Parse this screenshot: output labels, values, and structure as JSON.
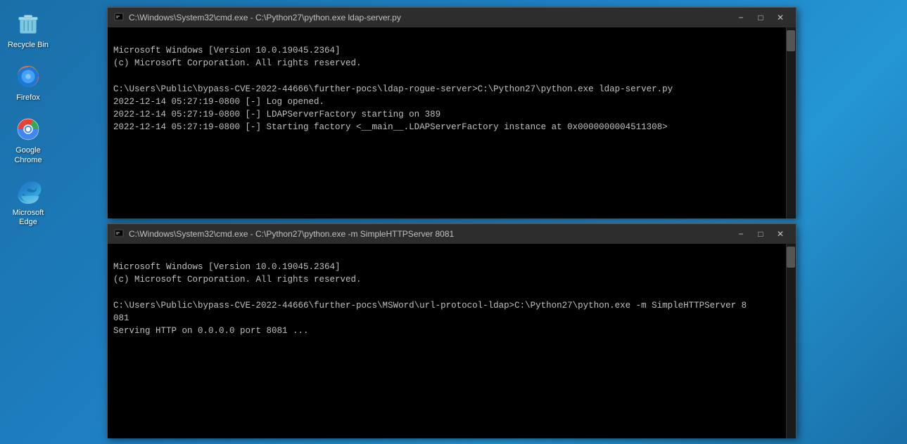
{
  "desktop": {
    "icons": [
      {
        "id": "recycle-bin",
        "label": "Recycle Bin",
        "type": "recycle"
      },
      {
        "id": "firefox",
        "label": "Firefox",
        "type": "firefox"
      },
      {
        "id": "chrome",
        "label": "Google Chrome",
        "type": "chrome"
      },
      {
        "id": "edge",
        "label": "Microsoft Edge",
        "type": "edge"
      }
    ]
  },
  "windows": [
    {
      "id": "cmd-ldap",
      "title": "C:\\Windows\\System32\\cmd.exe - C:\\Python27\\python.exe ldap-server.py",
      "minimize_label": "−",
      "maximize_label": "□",
      "close_label": "✕",
      "content": [
        "Microsoft Windows [Version 10.0.19045.2364]",
        "(c) Microsoft Corporation. All rights reserved.",
        "",
        "C:\\Users\\Public\\bypass-CVE-2022-44666\\further-pocs\\ldap-rogue-server>C:\\Python27\\python.exe ldap-server.py",
        "2022-12-14 05:27:19-0800 [-] Log opened.",
        "2022-12-14 05:27:19-0800 [-] LDAPServerFactory starting on 389",
        "2022-12-14 05:27:19-0800 [-] Starting factory <__main__.LDAPServerFactory instance at 0x0000000004511308>"
      ]
    },
    {
      "id": "cmd-http",
      "title": "C:\\Windows\\System32\\cmd.exe - C:\\Python27\\python.exe -m SimpleHTTPServer 8081",
      "minimize_label": "−",
      "maximize_label": "□",
      "close_label": "✕",
      "content": [
        "Microsoft Windows [Version 10.0.19045.2364]",
        "(c) Microsoft Corporation. All rights reserved.",
        "",
        "C:\\Users\\Public\\bypass-CVE-2022-44666\\further-pocs\\MSWord\\url-protocol-ldap>C:\\Python27\\python.exe -m SimpleHTTPServer 8",
        "081",
        "Serving HTTP on 0.0.0.0 port 8081 ..."
      ]
    }
  ],
  "colors": {
    "titlebar_bg": "#2d2d2d",
    "cmd_bg": "#000000",
    "cmd_text": "#c0c0c0",
    "scrollbar_bg": "#1a1a1a",
    "scrollbar_thumb": "#555555"
  }
}
